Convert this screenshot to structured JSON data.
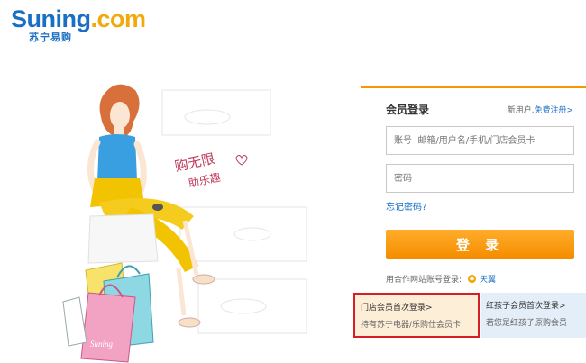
{
  "logo": {
    "word_part1": "Suning",
    "word_part2": ".com",
    "subtitle": "苏宁易购"
  },
  "illustration": {
    "slogan_line1": "购无限",
    "slogan_line2": "助乐趣",
    "bag_text": "Suning"
  },
  "login": {
    "title": "会员登录",
    "register_prompt": "新用户,",
    "register_link": "免费注册>",
    "username_placeholder": "账号  邮箱/用户名/手机/门店会员卡",
    "password_placeholder": "密码",
    "forgot_password": "忘记密码?",
    "login_button": "登 录",
    "partner_label": "用合作网站账号登录:",
    "partner_name": "天翼"
  },
  "store_member": {
    "line1": "门店会员首次登录>",
    "line2": "持有苏宁电器/乐购仕会员卡"
  },
  "kid_member": {
    "line1": "红孩子会员首次登录>",
    "line2": "若您是红孩子原购会员"
  },
  "colors": {
    "brand_blue": "#1a6fc4",
    "brand_orange": "#f39800",
    "highlight_red": "#d51f26"
  }
}
